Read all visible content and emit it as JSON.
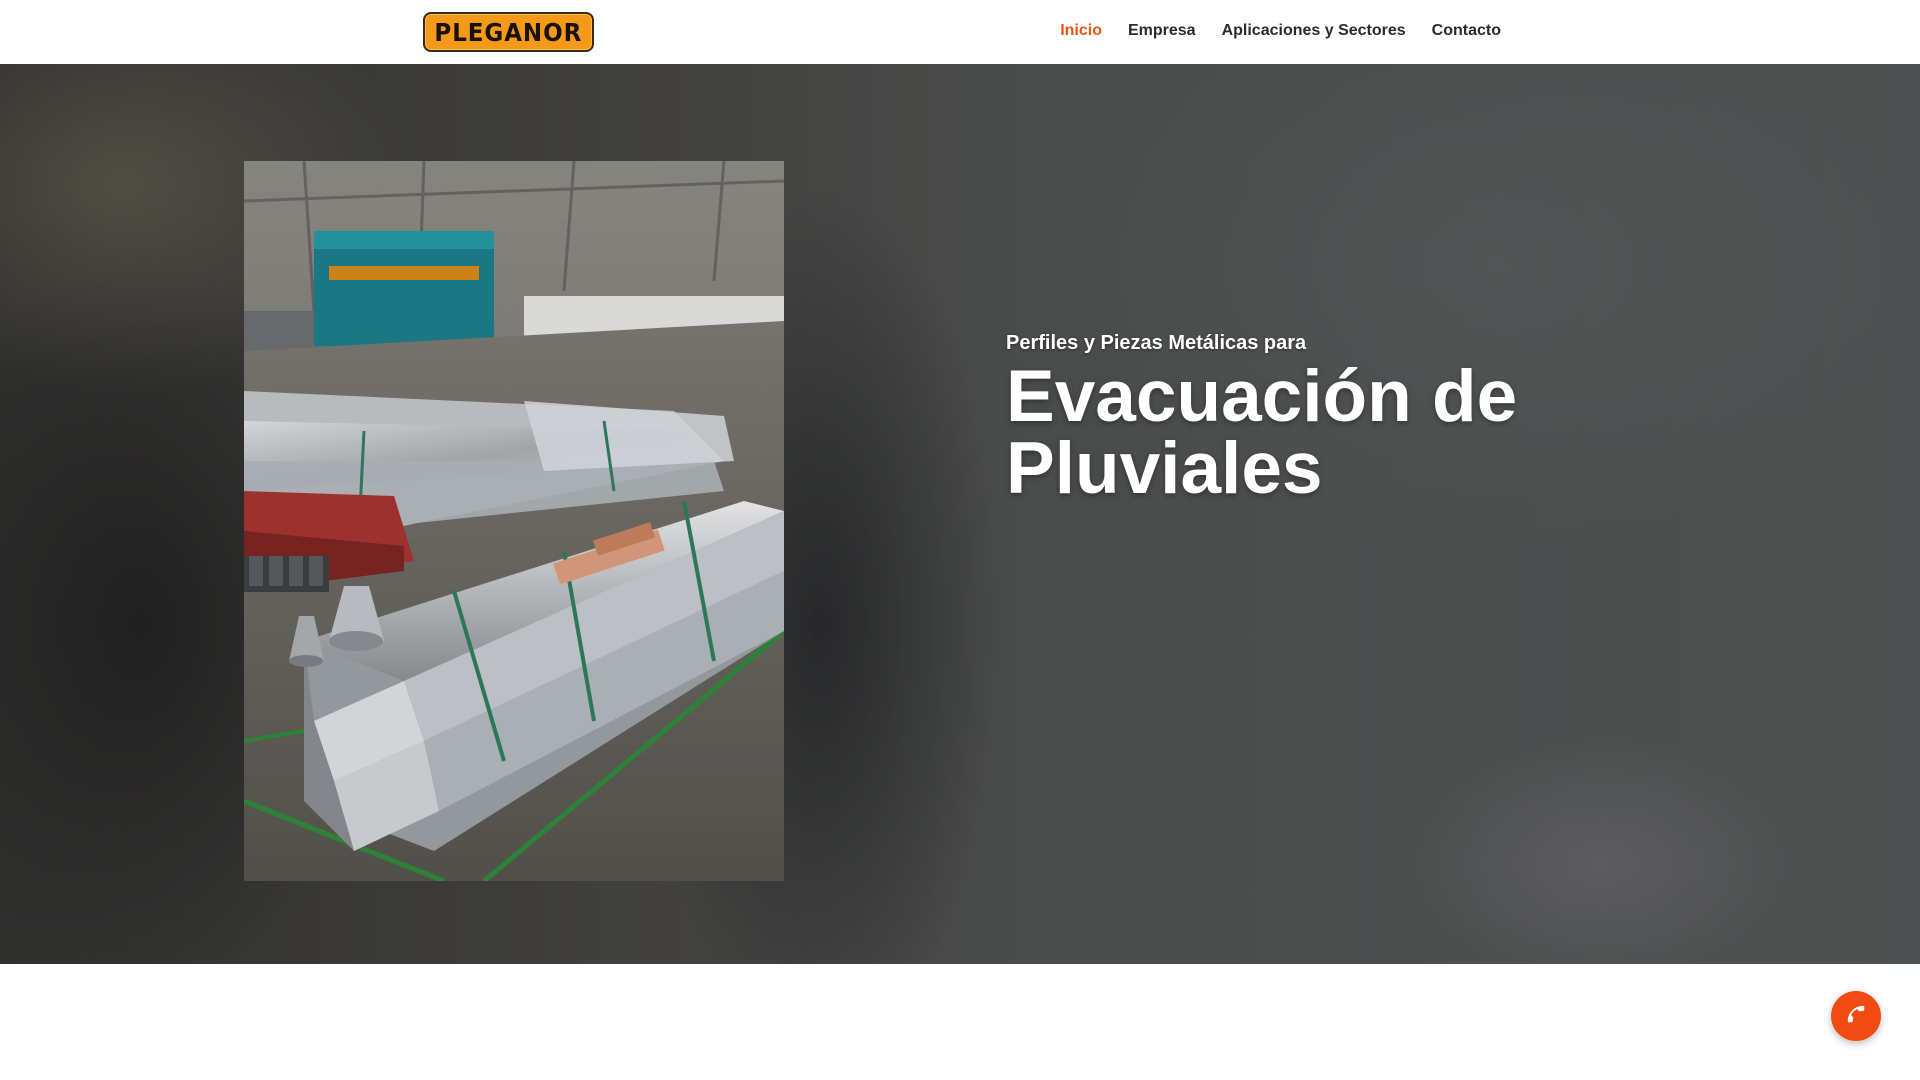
{
  "header": {
    "logo_text": "PLEGANOR",
    "nav": [
      {
        "label": "Inicio",
        "active": true
      },
      {
        "label": "Empresa",
        "active": false
      },
      {
        "label": "Aplicaciones y Sectores",
        "active": false
      },
      {
        "label": "Contacto",
        "active": false
      }
    ]
  },
  "hero": {
    "subtitle": "Perfiles y Piezas Metálicas para",
    "title_line1": "Evacuación de",
    "title_line2": "Pluviales"
  },
  "colors": {
    "accent": "#e8540f",
    "call_button": "#f24a13",
    "logo_bg": "#f39a1b",
    "nav_text": "#2b2b2b"
  },
  "icons": {
    "call_button": "phone-icon"
  }
}
